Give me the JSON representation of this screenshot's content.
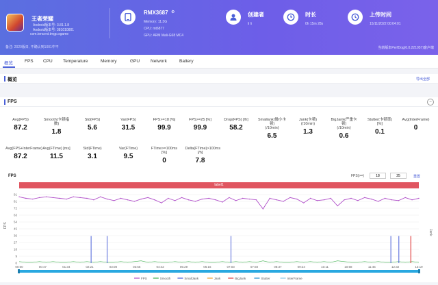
{
  "app": {
    "name": "王者荣耀",
    "android_ver": "Android版本号: 3.81.1.8",
    "android_code": "Android版本号: 381010801",
    "package": "com.tencent.tmgp.sgame",
    "note": "备注: 2020版日, 不确认到1001中平"
  },
  "device": {
    "model": "RMX3687",
    "memory": "Memory: 11.3G",
    "cpu": "CPU: mt6877",
    "gpu": "GPU: ARM Mali-G68 MC4"
  },
  "creator": {
    "label": "创建者",
    "value": "li li"
  },
  "duration": {
    "label": "时长",
    "value": "0h 15m 28s"
  },
  "upload": {
    "label": "上传时间",
    "value": "15/11/2022 00:04:01",
    "version": "当前版本PerfDog(6.0.221057)客户端"
  },
  "tabs": [
    "概览",
    "FPS",
    "CPU",
    "Temperature",
    "Memory",
    "GPU",
    "Network",
    "Battery"
  ],
  "overview": {
    "title": "概览",
    "export": "导出全部"
  },
  "fps_section": {
    "title": "FPS"
  },
  "metrics_row1": [
    {
      "label": "Avg(FPS)",
      "value": "87.2"
    },
    {
      "label": "Smooth(卡顿指数)",
      "value": "1.8"
    },
    {
      "label": "Std(FPS)",
      "value": "5.6"
    },
    {
      "label": "Var(FPS)",
      "value": "31.5"
    },
    {
      "label": "FPS>=18 [%]",
      "value": "99.9"
    },
    {
      "label": "FPS>=25 [%]",
      "value": "99.9"
    },
    {
      "label": "Drop(FPS) [/h]",
      "value": "58.2"
    },
    {
      "label": "Smallank(微小卡顿)\n(/10min)",
      "value": "6.5"
    },
    {
      "label": "Jank(卡顿)\n(/10min)",
      "value": "1.3"
    },
    {
      "label": "BigJank(严重卡顿)\n(/10min)",
      "value": "0.6"
    },
    {
      "label": "Stutter(卡顿率) [%]",
      "value": "0.1"
    },
    {
      "label": "Avg(InterFrame)",
      "value": "0"
    }
  ],
  "metrics_row2": [
    {
      "label": "Avg(FPS+InterFrame)",
      "value": "87.2"
    },
    {
      "label": "Avg(FTime) [ms]",
      "value": "11.5"
    },
    {
      "label": "Std(FTime)",
      "value": "3.1"
    },
    {
      "label": "Var(FTime)",
      "value": "9.5"
    },
    {
      "label": "FTime>=100ms [%]",
      "value": "0"
    },
    {
      "label": "Delta(FTime)>100ms [/h]",
      "value": "7.8"
    }
  ],
  "chart_controls": {
    "title": "FPS",
    "fps_label": "FPS(>=)",
    "v1": "18",
    "v2": "25",
    "reset": "重置"
  },
  "colors": {
    "accent": "#4a5fd8",
    "fps": "#b04fc9",
    "label_bar": "#e05560",
    "smalljank": "#4a5fd8",
    "jank": "#f0a030",
    "bigjank": "#e04040",
    "smooth": "#3fb04f",
    "stutter": "#1f8fd0"
  },
  "chart_data": {
    "type": "line",
    "label_bar": "label1",
    "ylim": [
      0,
      91
    ],
    "yticks": [
      "91",
      "81",
      "72",
      "63",
      "54",
      "45",
      "36",
      "27",
      "18",
      "9",
      "0"
    ],
    "ylabel": "FPS",
    "y2label": "Jank",
    "xticks": [
      "00:00",
      "00:47",
      "01:34",
      "02:21",
      "03:08",
      "03:55",
      "04:42",
      "05:29",
      "06:16",
      "07:03",
      "07:50",
      "08:37",
      "09:24",
      "10:11",
      "10:58",
      "11:45",
      "12:32",
      "13:19"
    ],
    "series": [
      {
        "name": "FPS",
        "values": [
          88,
          86,
          85,
          87,
          88,
          87,
          86,
          85,
          88,
          87,
          86,
          84,
          88,
          85,
          83,
          86,
          84,
          82,
          85,
          87,
          84,
          80,
          86,
          83,
          87,
          84,
          82,
          85,
          86,
          84,
          81,
          87,
          83,
          86,
          85,
          84,
          72,
          86,
          84,
          82,
          87,
          85,
          80,
          86,
          83,
          84,
          86,
          76,
          84,
          86,
          83,
          87,
          85,
          82,
          86,
          84,
          83,
          87,
          84,
          86
        ]
      },
      {
        "name": "Smooth",
        "values": [
          2,
          1,
          1,
          2,
          1,
          2,
          1,
          1,
          2,
          1,
          2,
          1,
          2,
          1,
          1,
          2,
          1,
          2,
          3,
          1,
          2,
          1,
          1,
          2,
          1,
          2,
          1,
          2,
          1,
          1,
          2,
          1,
          2,
          1,
          2,
          1,
          3,
          1,
          2,
          1,
          1,
          2,
          1,
          2,
          1,
          2,
          1,
          3,
          2,
          1,
          1,
          2,
          1,
          2,
          1,
          1,
          2,
          1,
          2,
          1
        ]
      }
    ],
    "spikes_smalljank": [
      0.18,
      0.22,
      0.53,
      0.93,
      0.95
    ],
    "spikes_bigjank": [
      0.98
    ],
    "legend": [
      "FPS",
      "Smooth",
      "SmallJank",
      "Jank",
      "BigJank",
      "Stutter",
      "InterFrame"
    ]
  }
}
